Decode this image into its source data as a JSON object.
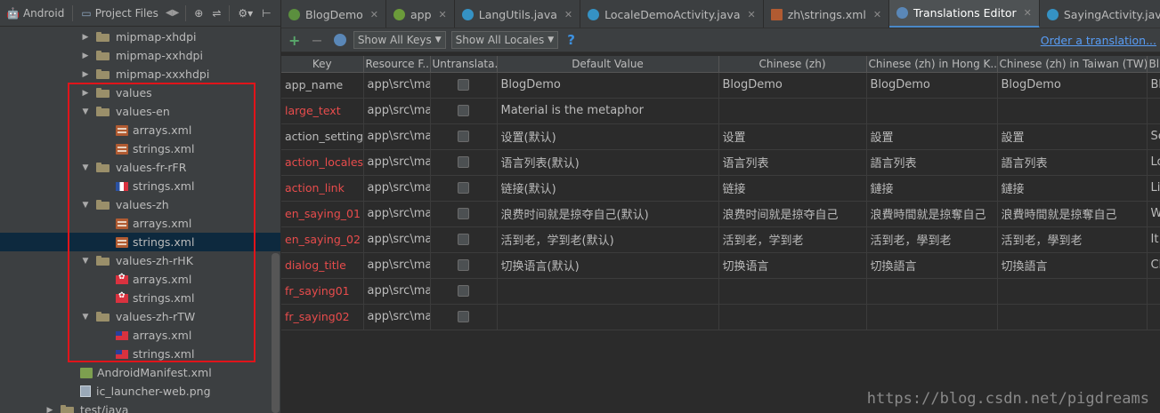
{
  "left_toolbar": {
    "view_label": "Android",
    "project_files_label": "Project Files",
    "arrows": "◀▶",
    "target_icon": "crosshair-icon",
    "collapse_icon": "collapse-icon",
    "settings_icon": "gear-icon",
    "hide_icon": "hide-icon"
  },
  "tree": [
    {
      "label": "mipmap-xhdpi",
      "type": "folder",
      "indent": 90,
      "expanded": false
    },
    {
      "label": "mipmap-xxhdpi",
      "type": "folder",
      "indent": 90,
      "expanded": false
    },
    {
      "label": "mipmap-xxxhdpi",
      "type": "folder",
      "indent": 90,
      "expanded": false
    },
    {
      "label": "values",
      "type": "folder",
      "indent": 90,
      "expanded": false
    },
    {
      "label": "values-en",
      "type": "folder",
      "indent": 90,
      "expanded": true
    },
    {
      "label": "arrays.xml",
      "type": "xml",
      "indent": 130
    },
    {
      "label": "strings.xml",
      "type": "xml",
      "indent": 130
    },
    {
      "label": "values-fr-rFR",
      "type": "folder",
      "indent": 90,
      "expanded": true
    },
    {
      "label": "strings.xml",
      "type": "flag-fr",
      "indent": 130
    },
    {
      "label": "values-zh",
      "type": "folder",
      "indent": 90,
      "expanded": true
    },
    {
      "label": "arrays.xml",
      "type": "xml",
      "indent": 130
    },
    {
      "label": "strings.xml",
      "type": "xml",
      "indent": 130,
      "selected": true
    },
    {
      "label": "values-zh-rHK",
      "type": "folder",
      "indent": 90,
      "expanded": true
    },
    {
      "label": "arrays.xml",
      "type": "flag-hk",
      "indent": 130
    },
    {
      "label": "strings.xml",
      "type": "flag-hk",
      "indent": 130
    },
    {
      "label": "values-zh-rTW",
      "type": "folder",
      "indent": 90,
      "expanded": true
    },
    {
      "label": "arrays.xml",
      "type": "flag-tw",
      "indent": 130
    },
    {
      "label": "strings.xml",
      "type": "flag-tw",
      "indent": 130
    },
    {
      "label": "AndroidManifest.xml",
      "type": "manifest",
      "indent": 90
    },
    {
      "label": "ic_launcher-web.png",
      "type": "png",
      "indent": 90
    },
    {
      "label": "test/java",
      "type": "folder",
      "indent": 50,
      "expanded": false
    }
  ],
  "tabs": [
    {
      "label": "BlogDemo",
      "icon": "c-green",
      "icon_name": "module-icon",
      "closable": true
    },
    {
      "label": "app",
      "icon": "c-green2",
      "icon_name": "module-icon",
      "closable": true
    },
    {
      "label": "LangUtils.java",
      "icon": "c-class",
      "icon_name": "class-icon",
      "closable": true
    },
    {
      "label": "LocaleDemoActivity.java",
      "icon": "c-class",
      "icon_name": "class-icon",
      "closable": true
    },
    {
      "label": "zh\\strings.xml",
      "icon": "c-xml",
      "icon_name": "xml-file-icon",
      "closable": true
    },
    {
      "label": "Translations Editor",
      "icon": "c-globe",
      "icon_name": "globe-icon",
      "closable": true,
      "active": true
    },
    {
      "label": "SayingActivity.java",
      "icon": "c-class",
      "icon_name": "class-icon",
      "closable": true
    }
  ],
  "tabs_overflow": "⋮≡",
  "toolbar": {
    "add_icon": "+",
    "remove_icon": "−",
    "keys_filter": "Show All Keys",
    "locales_filter": "Show All Locales",
    "help": "?",
    "order_link": "Order a translation..."
  },
  "columns": [
    "Key",
    "Resource F...",
    "Untranslata...",
    "Default Value",
    "Chinese (zh)",
    "Chinese (zh) in Hong K...",
    "Chinese (zh) in Taiwan (TW)",
    "Bl"
  ],
  "rows": [
    {
      "key": "app_name",
      "missing": false,
      "folder": "app\\src\\mai",
      "default": "BlogDemo",
      "zh": "BlogDemo",
      "hk": "BlogDemo",
      "tw": "BlogDemo",
      "extra": "Bl"
    },
    {
      "key": "large_text",
      "missing": true,
      "folder": "app\\src\\mai",
      "default": "Material is the metaphor",
      "zh": "",
      "hk": "",
      "tw": "",
      "extra": ""
    },
    {
      "key": "action_settings",
      "missing": false,
      "folder": "app\\src\\mai",
      "default": "设置(默认)",
      "zh": "设置",
      "hk": "設置",
      "tw": "設置",
      "extra": "Se"
    },
    {
      "key": "action_locales",
      "missing": true,
      "folder": "app\\src\\mai",
      "default": "语言列表(默认)",
      "zh": "语言列表",
      "hk": "語言列表",
      "tw": "語言列表",
      "extra": "Lo"
    },
    {
      "key": "action_link",
      "missing": true,
      "folder": "app\\src\\mai",
      "default": "链接(默认)",
      "zh": "链接",
      "hk": "鏈接",
      "tw": "鏈接",
      "extra": "Lir"
    },
    {
      "key": "en_saying_01",
      "missing": true,
      "folder": "app\\src\\mai",
      "default": "浪费时间就是掠夺自己(默认)",
      "zh": "浪费时间就是掠夺自己",
      "hk": "浪費時間就是掠奪自己",
      "tw": "浪費時間就是掠奪自己",
      "extra": "W"
    },
    {
      "key": "en_saying_02",
      "missing": true,
      "folder": "app\\src\\mai",
      "default": "活到老，学到老(默认)",
      "zh": "活到老，学到老",
      "hk": "活到老，學到老",
      "tw": "活到老，學到老",
      "extra": "It"
    },
    {
      "key": "dialog_title",
      "missing": true,
      "folder": "app\\src\\mai",
      "default": "切换语言(默认)",
      "zh": "切换语言",
      "hk": "切換語言",
      "tw": "切換語言",
      "extra": "Ch"
    },
    {
      "key": "fr_saying01",
      "missing": true,
      "folder": "app\\src\\mai",
      "default": "",
      "zh": "",
      "hk": "",
      "tw": "",
      "extra": ""
    },
    {
      "key": "fr_saying02",
      "missing": true,
      "folder": "app\\src\\mai",
      "default": "",
      "zh": "",
      "hk": "",
      "tw": "",
      "extra": ""
    }
  ],
  "watermark": "https://blog.csdn.net/pigdreams",
  "colors": {
    "background": "#2b2b2b",
    "panel": "#3c3f41",
    "selection": "#0d293e",
    "missing_key": "#e84c4c",
    "link": "#589df6",
    "highlight_box": "#e0141a",
    "active_tab_underline": "#4a88c7"
  }
}
